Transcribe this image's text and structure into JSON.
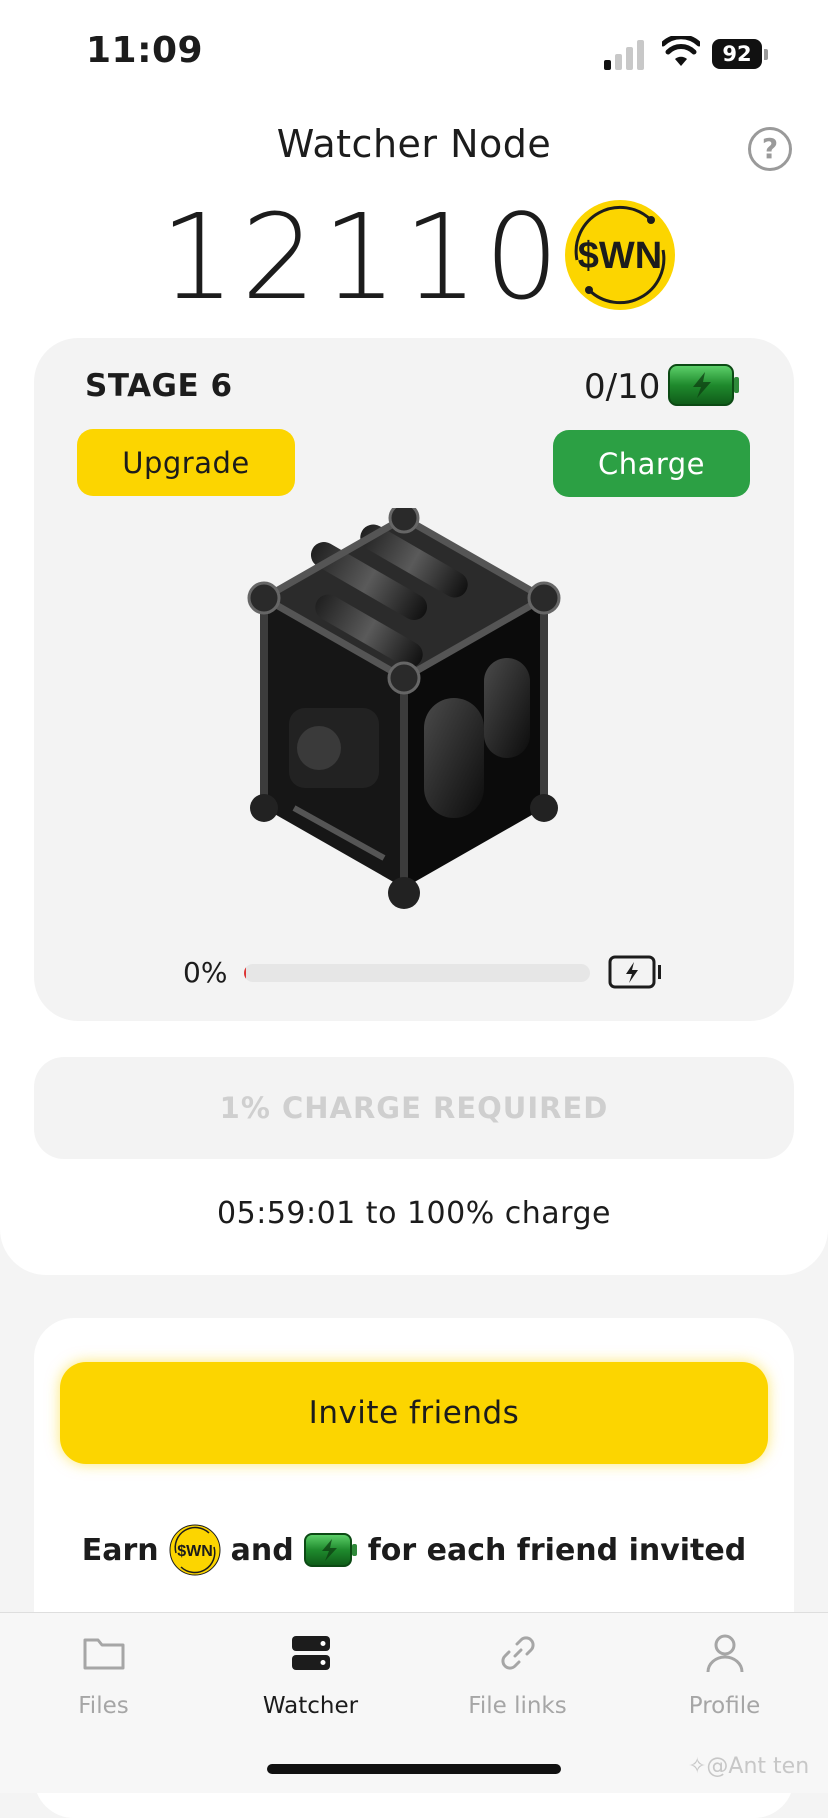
{
  "status_bar": {
    "time": "11:09",
    "battery_level": "92"
  },
  "header": {
    "title": "Watcher Node",
    "help_icon": "question-circle-icon",
    "help_symbol": "?"
  },
  "balance": {
    "amount": "12110",
    "coin_label": "$WN"
  },
  "stage": {
    "label": "STAGE 6",
    "charges": "0/10",
    "upgrade_label": "Upgrade",
    "charge_label": "Charge",
    "progress_text": "0%",
    "progress_value": 0.005
  },
  "charge": {
    "required_label": "1% CHARGE REQUIRED",
    "eta_text": "05:59:01 to 100% charge"
  },
  "invite": {
    "button_label": "Invite friends",
    "earn_prefix": "Earn",
    "earn_middle": "and",
    "earn_suffix": "for each friend invited",
    "coin_label": "$WN"
  },
  "tabs": [
    {
      "label": "Files",
      "icon": "folder-icon",
      "active": false
    },
    {
      "label": "Watcher",
      "icon": "server-icon",
      "active": true
    },
    {
      "label": "File links",
      "icon": "link-icon",
      "active": false
    },
    {
      "label": "Profile",
      "icon": "user-icon",
      "active": false
    }
  ],
  "watermark": "✧@Ant ten",
  "colors": {
    "accent_yellow": "#fcd500",
    "charge_green": "#2ca044",
    "disabled_text": "#cfcfcf"
  }
}
